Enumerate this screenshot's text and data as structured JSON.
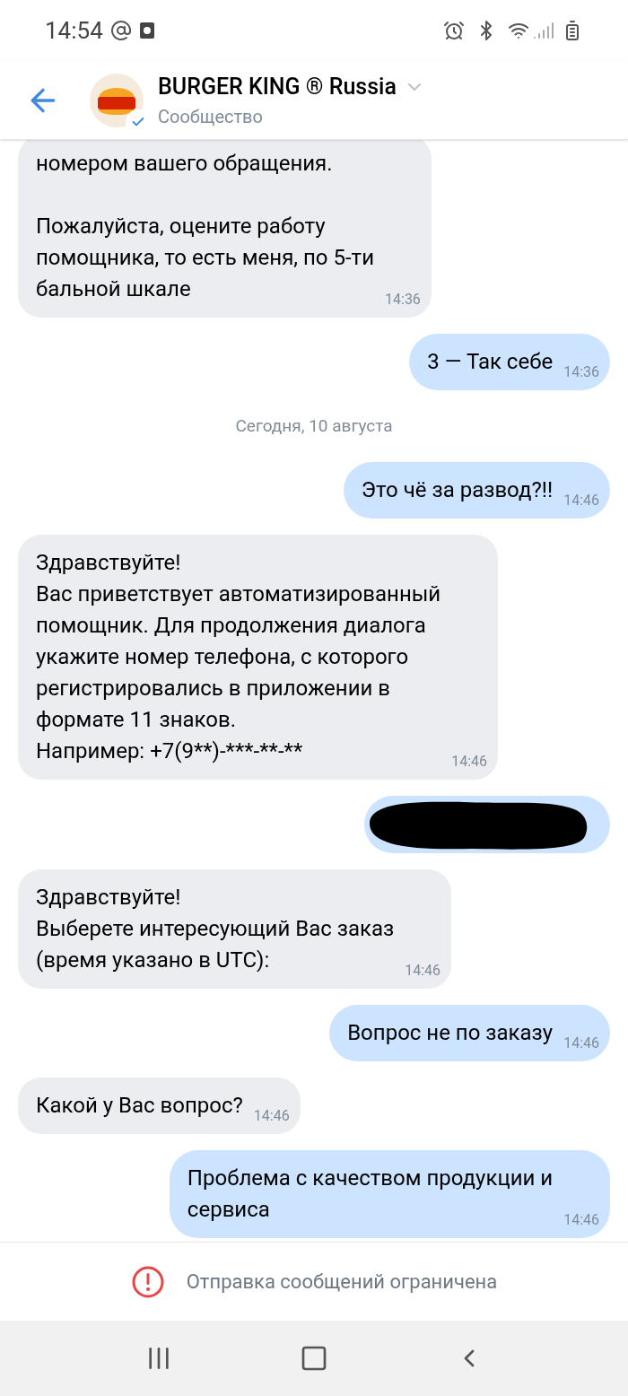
{
  "status_bar": {
    "time": "14:54"
  },
  "header": {
    "title": "BURGER KING ® Russia",
    "subtitle": "Сообщество"
  },
  "messages": [
    {
      "kind": "in",
      "text": "номером вашего обращения.\n\nПожалуйста, оцените работу\nпомощника, то есть меня, по 5-ти\nбальной шкале",
      "time": "14:36"
    },
    {
      "kind": "out",
      "text": "3 — Так себе",
      "time": "14:36"
    },
    {
      "kind": "date",
      "text": "Сегодня, 10 августа"
    },
    {
      "kind": "out",
      "text": "Это чё за развод?!!",
      "time": "14:46"
    },
    {
      "kind": "in",
      "text": "Здравствуйте!\nВас приветствует автоматизированный\nпомощник. Для продолжения диалога\nукажите номер телефона, с которого\nрегистрировались в приложении в\nформате 11 знаков.\nНапример: +7(9**)-***-**-**",
      "time": "14:46"
    },
    {
      "kind": "redacted"
    },
    {
      "kind": "in",
      "text": "Здравствуйте!\nВыберете интересующий Вас заказ\n(время указано в UTC):",
      "time": "14:46"
    },
    {
      "kind": "out",
      "text": "Вопрос не по заказу",
      "time": "14:46"
    },
    {
      "kind": "in",
      "text": "Какой у Вас вопрос?",
      "time": "14:46"
    },
    {
      "kind": "out",
      "text": "Проблема с качеством продукции и\nсервиса",
      "time": "14:46"
    }
  ],
  "notice": "Отправка сообщений ограничена"
}
